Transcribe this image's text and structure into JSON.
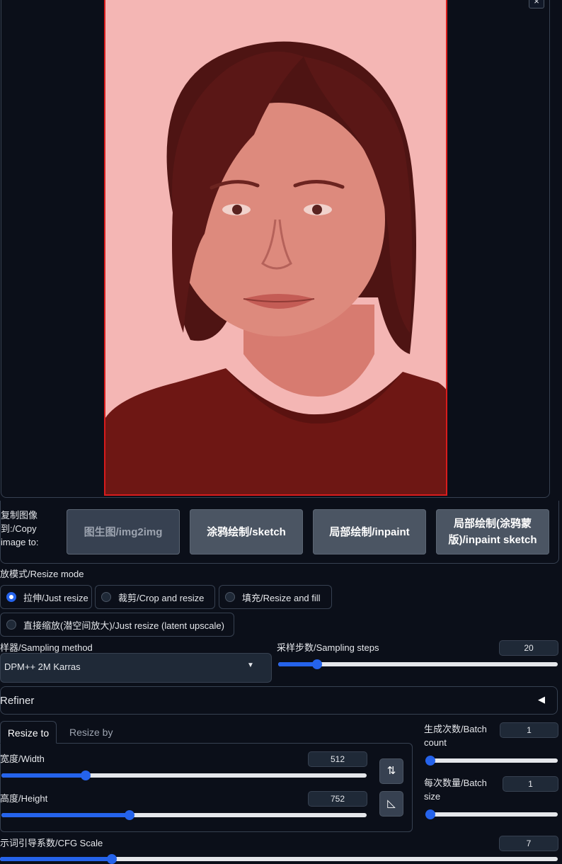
{
  "image": {
    "close_label": "×"
  },
  "copy": {
    "label": "复制图像到:/Copy image to:",
    "buttons": {
      "img2img": "图生图/img2img",
      "sketch": "涂鸦绘制/sketch",
      "inpaint": "局部绘制/inpaint",
      "inpaint_sketch": "局部绘制(涂鸦蒙版)/inpaint sketch"
    }
  },
  "resize_mode": {
    "label": "放模式/Resize mode",
    "options": {
      "just_resize": "拉伸/Just resize",
      "crop_resize": "裁剪/Crop and resize",
      "resize_fill": "填充/Resize and fill",
      "latent_upscale": "直接缩放(潜空间放大)/Just resize (latent upscale)"
    },
    "selected": "拉伸/Just resize"
  },
  "sampler": {
    "label": "样器/Sampling method",
    "value": "DPM++ 2M Karras"
  },
  "steps": {
    "label": "采样步数/Sampling steps",
    "value": "20",
    "fraction": 0.14
  },
  "refiner": {
    "label": "Refiner",
    "arrow": "◀"
  },
  "tabs": {
    "resize_to": "Resize to",
    "resize_by": "Resize by"
  },
  "width": {
    "label": "宽度/Width",
    "value": "512",
    "fraction": 0.23
  },
  "height": {
    "label": "高度/Height",
    "value": "752",
    "fraction": 0.35
  },
  "swap_icon": "⇅",
  "ratio_icon": "◺",
  "batch_count": {
    "label": "生成次数/Batch count",
    "value": "1",
    "fraction": 0.0
  },
  "batch_size": {
    "label": "每次数量/Batch size",
    "value": "1",
    "fraction": 0.0
  },
  "cfg": {
    "label": "示词引导系数/CFG Scale",
    "value": "7",
    "fraction": 0.2
  },
  "colors": {
    "accent": "#2563eb",
    "mask_border": "#d91c1c",
    "background": "#0b0f19"
  }
}
